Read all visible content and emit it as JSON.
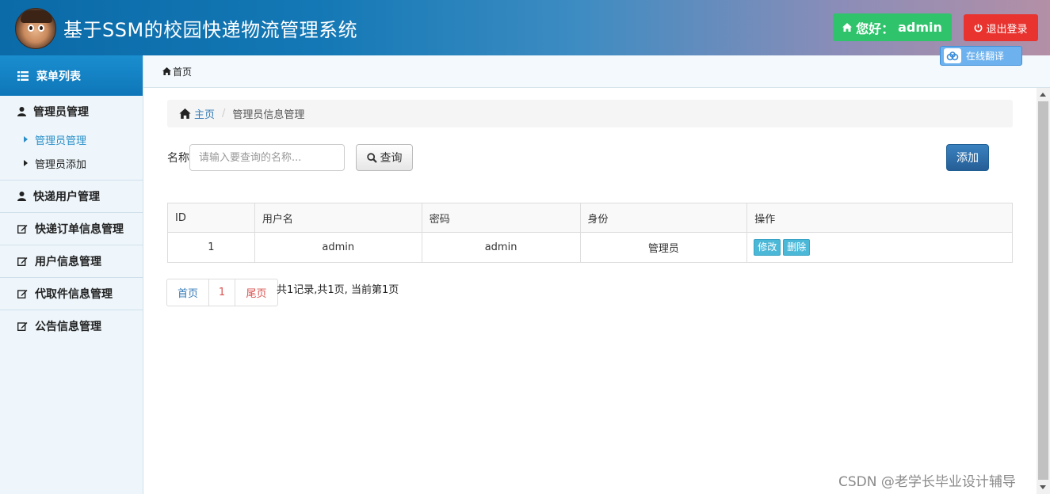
{
  "header": {
    "title": "基于SSM的校园快递物流管理系统",
    "greeting": "您好：",
    "username": "admin",
    "logout_label": "退出登录",
    "translate_label": "在线翻译"
  },
  "sidebar": {
    "menu_title": "菜单列表",
    "groups": [
      {
        "label": "管理员管理",
        "items": [
          "管理员管理",
          "管理员添加"
        ]
      },
      {
        "label": "快递用户管理"
      },
      {
        "label": "快递订单信息管理"
      },
      {
        "label": "用户信息管理"
      },
      {
        "label": "代取件信息管理"
      },
      {
        "label": "公告信息管理"
      }
    ]
  },
  "topbar": {
    "label": "首页"
  },
  "breadcrumb": {
    "home": "主页",
    "current": "管理员信息管理"
  },
  "search": {
    "label": "名称",
    "placeholder": "请输入要查询的名称...",
    "query_label": "查询",
    "add_label": "添加"
  },
  "table": {
    "headers": [
      "ID",
      "用户名",
      "密码",
      "身份",
      "操作"
    ],
    "rows": [
      {
        "id": "1",
        "username": "admin",
        "password": "admin",
        "role": "管理员",
        "edit": "修改",
        "delete": "删除"
      }
    ]
  },
  "pagination": {
    "first": "首页",
    "current": "1",
    "last": "尾页",
    "info": "共1记录,共1页, 当前第1页"
  },
  "watermark": "CSDN @老学长毕业设计辅导",
  "colors": {
    "header_start": "#0b6aa8",
    "greet_green": "#2fc36b",
    "logout_red": "#e8332f",
    "link_blue": "#337ab7"
  }
}
